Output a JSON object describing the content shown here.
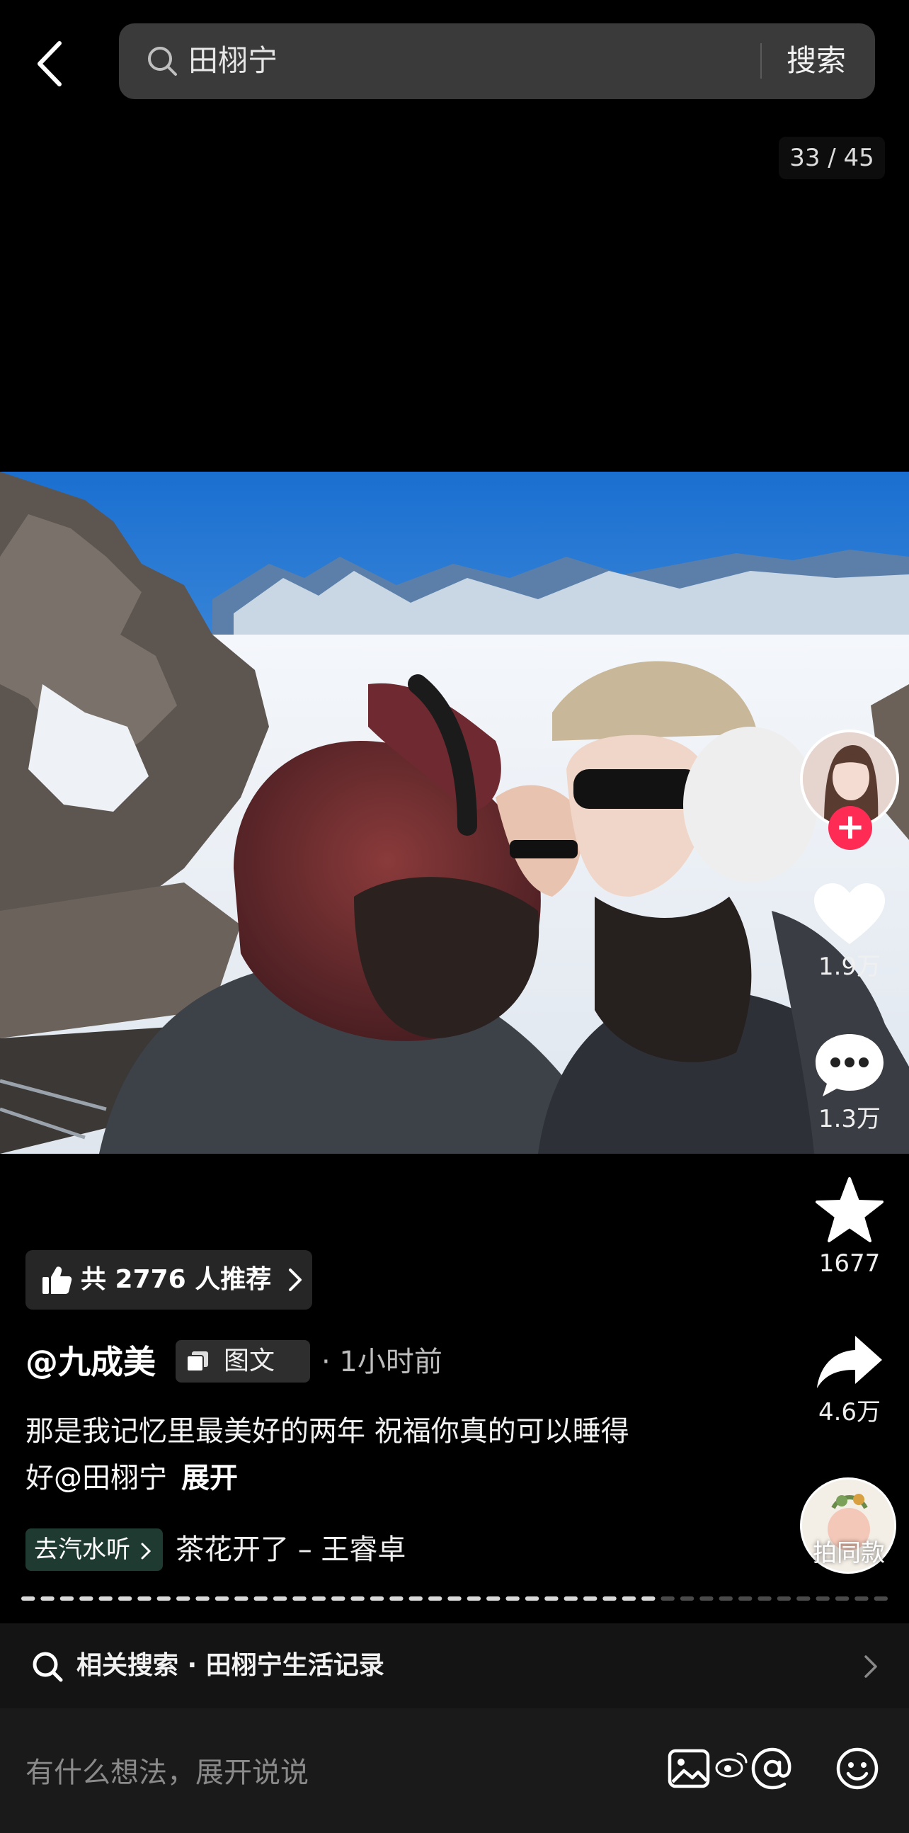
{
  "header": {
    "search_query": "田栩宁",
    "search_button": "搜索",
    "page_counter": "33 / 45"
  },
  "actions": {
    "likes": "1.9万",
    "comments": "1.3万",
    "favorites": "1677",
    "shares": "4.6万",
    "same_style_label": "拍同款"
  },
  "post": {
    "recommend_text": "共 2776 人推荐",
    "author": "@九成美",
    "type_badge": "图文",
    "time": "· 1小时前",
    "caption_line1": "那是我记忆里最美好的两年 祝福你真的可以睡得",
    "caption_line2_prefix": "好",
    "caption_mention": "@田栩宁",
    "caption_expand": "展开",
    "listen_label": "去汽水听",
    "music_title": "茶花开了 – 王睿卓"
  },
  "related": {
    "text": "相关搜索 · 田栩宁生活记录"
  },
  "comment_bar": {
    "placeholder": "有什么想法，展开说说"
  },
  "progress": {
    "total": 45,
    "current": 33
  },
  "colors": {
    "follow_red": "#fe2c55",
    "listen_green": "#1f3a30",
    "sky_blue": "#2a7fd0"
  }
}
